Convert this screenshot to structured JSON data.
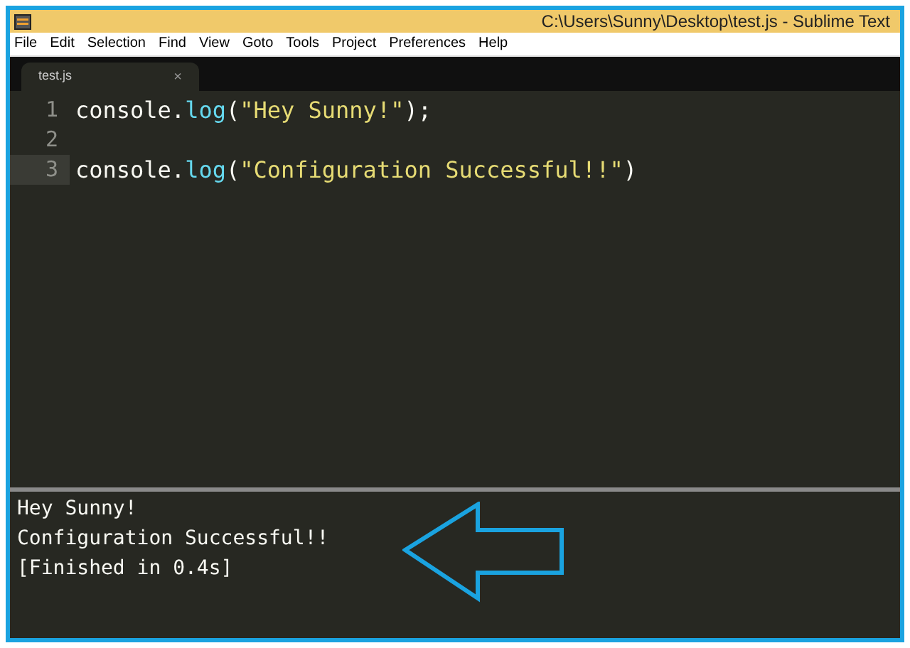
{
  "window": {
    "title": "C:\\Users\\Sunny\\Desktop\\test.js - Sublime Text"
  },
  "menu": [
    "File",
    "Edit",
    "Selection",
    "Find",
    "View",
    "Goto",
    "Tools",
    "Project",
    "Preferences",
    "Help"
  ],
  "tabs": [
    {
      "label": "test.js",
      "close": "×",
      "selected": true
    }
  ],
  "editor": {
    "lines": [
      {
        "number": "1",
        "current": false,
        "tokens": [
          {
            "kind": "plain",
            "text": "console."
          },
          {
            "kind": "func",
            "text": "log"
          },
          {
            "kind": "plain",
            "text": "("
          },
          {
            "kind": "string",
            "text": "\"Hey Sunny!\""
          },
          {
            "kind": "plain",
            "text": ");"
          }
        ]
      },
      {
        "number": "2",
        "current": false
      },
      {
        "number": "3",
        "current": true,
        "tokens": [
          {
            "kind": "plain",
            "text": "console."
          },
          {
            "kind": "func",
            "text": "log"
          },
          {
            "kind": "plain",
            "text": "("
          },
          {
            "kind": "string",
            "text": "\"Configuration Successful!!\""
          },
          {
            "kind": "plain",
            "text": ")"
          }
        ]
      }
    ]
  },
  "output": {
    "lines": [
      "Hey Sunny!",
      "Configuration Successful!!",
      "[Finished in 0.4s]"
    ]
  }
}
